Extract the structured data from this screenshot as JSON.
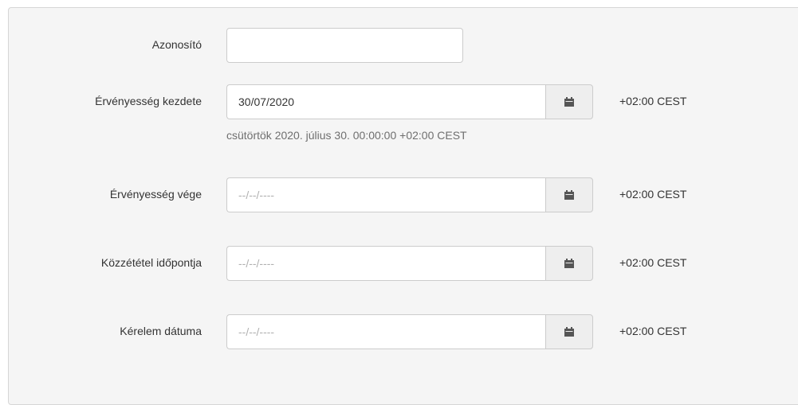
{
  "form": {
    "id_field": {
      "label": "Azonosító",
      "value": "",
      "placeholder": ""
    },
    "validity_start": {
      "label": "Érvényesség kezdete",
      "value": "30/07/2020",
      "placeholder": "",
      "timezone": "+02:00 CEST",
      "help_text": "csütörtök 2020. július 30. 00:00:00 +02:00 CEST"
    },
    "validity_end": {
      "label": "Érvényesség vége",
      "value": "",
      "placeholder": "--/--/----",
      "timezone": "+02:00 CEST"
    },
    "publication_time": {
      "label": "Közzététel időpontja",
      "value": "",
      "placeholder": "--/--/----",
      "timezone": "+02:00 CEST"
    },
    "request_date": {
      "label": "Kérelem dátuma",
      "value": "",
      "placeholder": "--/--/----",
      "timezone": "+02:00 CEST"
    }
  },
  "icons": {
    "calendar": "calendar-icon"
  },
  "colors": {
    "panel_bg": "#f5f5f5",
    "border": "#cccccc",
    "button_bg": "#eeeeee",
    "icon": "#555555"
  }
}
